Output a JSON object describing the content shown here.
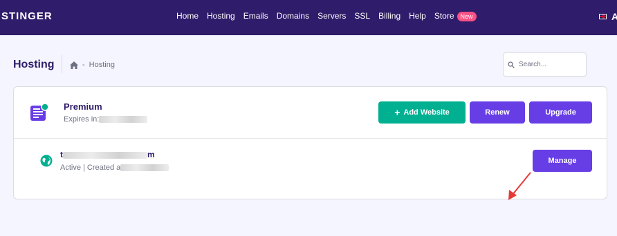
{
  "topbar": {
    "brand": "STINGER",
    "nav": [
      {
        "label": "Home"
      },
      {
        "label": "Hosting"
      },
      {
        "label": "Emails"
      },
      {
        "label": "Domains"
      },
      {
        "label": "Servers"
      },
      {
        "label": "SSL"
      },
      {
        "label": "Billing"
      },
      {
        "label": "Help"
      },
      {
        "label": "Store"
      }
    ],
    "store_badge": "New",
    "partial_text": "A"
  },
  "page": {
    "title": "Hosting",
    "breadcrumb_sep": "-",
    "breadcrumb_current": "Hosting"
  },
  "search": {
    "placeholder": "Search..."
  },
  "plan": {
    "name": "Premium",
    "expires_label": "Expires in:",
    "buttons": {
      "add_website": "Add Website",
      "renew": "Renew",
      "upgrade": "Upgrade"
    }
  },
  "website": {
    "name_start": "t",
    "name_end": "m",
    "status": "Active | Created a",
    "manage_label": "Manage"
  },
  "colors": {
    "nav_bg": "#2f1c6a",
    "primary": "#673de6",
    "success": "#00b090",
    "badge": "#fc5185",
    "annotation_arrow": "#e53935"
  }
}
